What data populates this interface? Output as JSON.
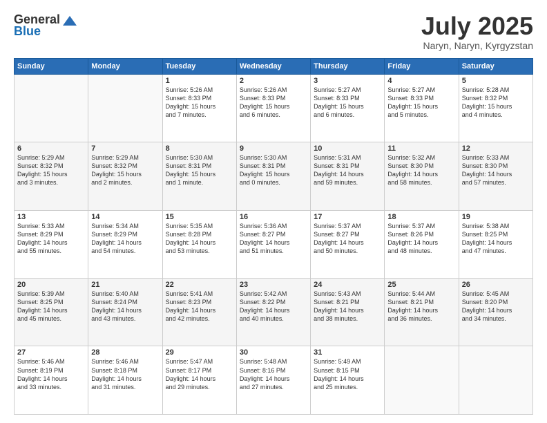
{
  "header": {
    "logo_general": "General",
    "logo_blue": "Blue",
    "month_title": "July 2025",
    "location": "Naryn, Naryn, Kyrgyzstan"
  },
  "weekdays": [
    "Sunday",
    "Monday",
    "Tuesday",
    "Wednesday",
    "Thursday",
    "Friday",
    "Saturday"
  ],
  "weeks": [
    [
      {
        "day": "",
        "info": ""
      },
      {
        "day": "",
        "info": ""
      },
      {
        "day": "1",
        "info": "Sunrise: 5:26 AM\nSunset: 8:33 PM\nDaylight: 15 hours\nand 7 minutes."
      },
      {
        "day": "2",
        "info": "Sunrise: 5:26 AM\nSunset: 8:33 PM\nDaylight: 15 hours\nand 6 minutes."
      },
      {
        "day": "3",
        "info": "Sunrise: 5:27 AM\nSunset: 8:33 PM\nDaylight: 15 hours\nand 6 minutes."
      },
      {
        "day": "4",
        "info": "Sunrise: 5:27 AM\nSunset: 8:33 PM\nDaylight: 15 hours\nand 5 minutes."
      },
      {
        "day": "5",
        "info": "Sunrise: 5:28 AM\nSunset: 8:32 PM\nDaylight: 15 hours\nand 4 minutes."
      }
    ],
    [
      {
        "day": "6",
        "info": "Sunrise: 5:29 AM\nSunset: 8:32 PM\nDaylight: 15 hours\nand 3 minutes."
      },
      {
        "day": "7",
        "info": "Sunrise: 5:29 AM\nSunset: 8:32 PM\nDaylight: 15 hours\nand 2 minutes."
      },
      {
        "day": "8",
        "info": "Sunrise: 5:30 AM\nSunset: 8:31 PM\nDaylight: 15 hours\nand 1 minute."
      },
      {
        "day": "9",
        "info": "Sunrise: 5:30 AM\nSunset: 8:31 PM\nDaylight: 15 hours\nand 0 minutes."
      },
      {
        "day": "10",
        "info": "Sunrise: 5:31 AM\nSunset: 8:31 PM\nDaylight: 14 hours\nand 59 minutes."
      },
      {
        "day": "11",
        "info": "Sunrise: 5:32 AM\nSunset: 8:30 PM\nDaylight: 14 hours\nand 58 minutes."
      },
      {
        "day": "12",
        "info": "Sunrise: 5:33 AM\nSunset: 8:30 PM\nDaylight: 14 hours\nand 57 minutes."
      }
    ],
    [
      {
        "day": "13",
        "info": "Sunrise: 5:33 AM\nSunset: 8:29 PM\nDaylight: 14 hours\nand 55 minutes."
      },
      {
        "day": "14",
        "info": "Sunrise: 5:34 AM\nSunset: 8:29 PM\nDaylight: 14 hours\nand 54 minutes."
      },
      {
        "day": "15",
        "info": "Sunrise: 5:35 AM\nSunset: 8:28 PM\nDaylight: 14 hours\nand 53 minutes."
      },
      {
        "day": "16",
        "info": "Sunrise: 5:36 AM\nSunset: 8:27 PM\nDaylight: 14 hours\nand 51 minutes."
      },
      {
        "day": "17",
        "info": "Sunrise: 5:37 AM\nSunset: 8:27 PM\nDaylight: 14 hours\nand 50 minutes."
      },
      {
        "day": "18",
        "info": "Sunrise: 5:37 AM\nSunset: 8:26 PM\nDaylight: 14 hours\nand 48 minutes."
      },
      {
        "day": "19",
        "info": "Sunrise: 5:38 AM\nSunset: 8:25 PM\nDaylight: 14 hours\nand 47 minutes."
      }
    ],
    [
      {
        "day": "20",
        "info": "Sunrise: 5:39 AM\nSunset: 8:25 PM\nDaylight: 14 hours\nand 45 minutes."
      },
      {
        "day": "21",
        "info": "Sunrise: 5:40 AM\nSunset: 8:24 PM\nDaylight: 14 hours\nand 43 minutes."
      },
      {
        "day": "22",
        "info": "Sunrise: 5:41 AM\nSunset: 8:23 PM\nDaylight: 14 hours\nand 42 minutes."
      },
      {
        "day": "23",
        "info": "Sunrise: 5:42 AM\nSunset: 8:22 PM\nDaylight: 14 hours\nand 40 minutes."
      },
      {
        "day": "24",
        "info": "Sunrise: 5:43 AM\nSunset: 8:21 PM\nDaylight: 14 hours\nand 38 minutes."
      },
      {
        "day": "25",
        "info": "Sunrise: 5:44 AM\nSunset: 8:21 PM\nDaylight: 14 hours\nand 36 minutes."
      },
      {
        "day": "26",
        "info": "Sunrise: 5:45 AM\nSunset: 8:20 PM\nDaylight: 14 hours\nand 34 minutes."
      }
    ],
    [
      {
        "day": "27",
        "info": "Sunrise: 5:46 AM\nSunset: 8:19 PM\nDaylight: 14 hours\nand 33 minutes."
      },
      {
        "day": "28",
        "info": "Sunrise: 5:46 AM\nSunset: 8:18 PM\nDaylight: 14 hours\nand 31 minutes."
      },
      {
        "day": "29",
        "info": "Sunrise: 5:47 AM\nSunset: 8:17 PM\nDaylight: 14 hours\nand 29 minutes."
      },
      {
        "day": "30",
        "info": "Sunrise: 5:48 AM\nSunset: 8:16 PM\nDaylight: 14 hours\nand 27 minutes."
      },
      {
        "day": "31",
        "info": "Sunrise: 5:49 AM\nSunset: 8:15 PM\nDaylight: 14 hours\nand 25 minutes."
      },
      {
        "day": "",
        "info": ""
      },
      {
        "day": "",
        "info": ""
      }
    ]
  ]
}
